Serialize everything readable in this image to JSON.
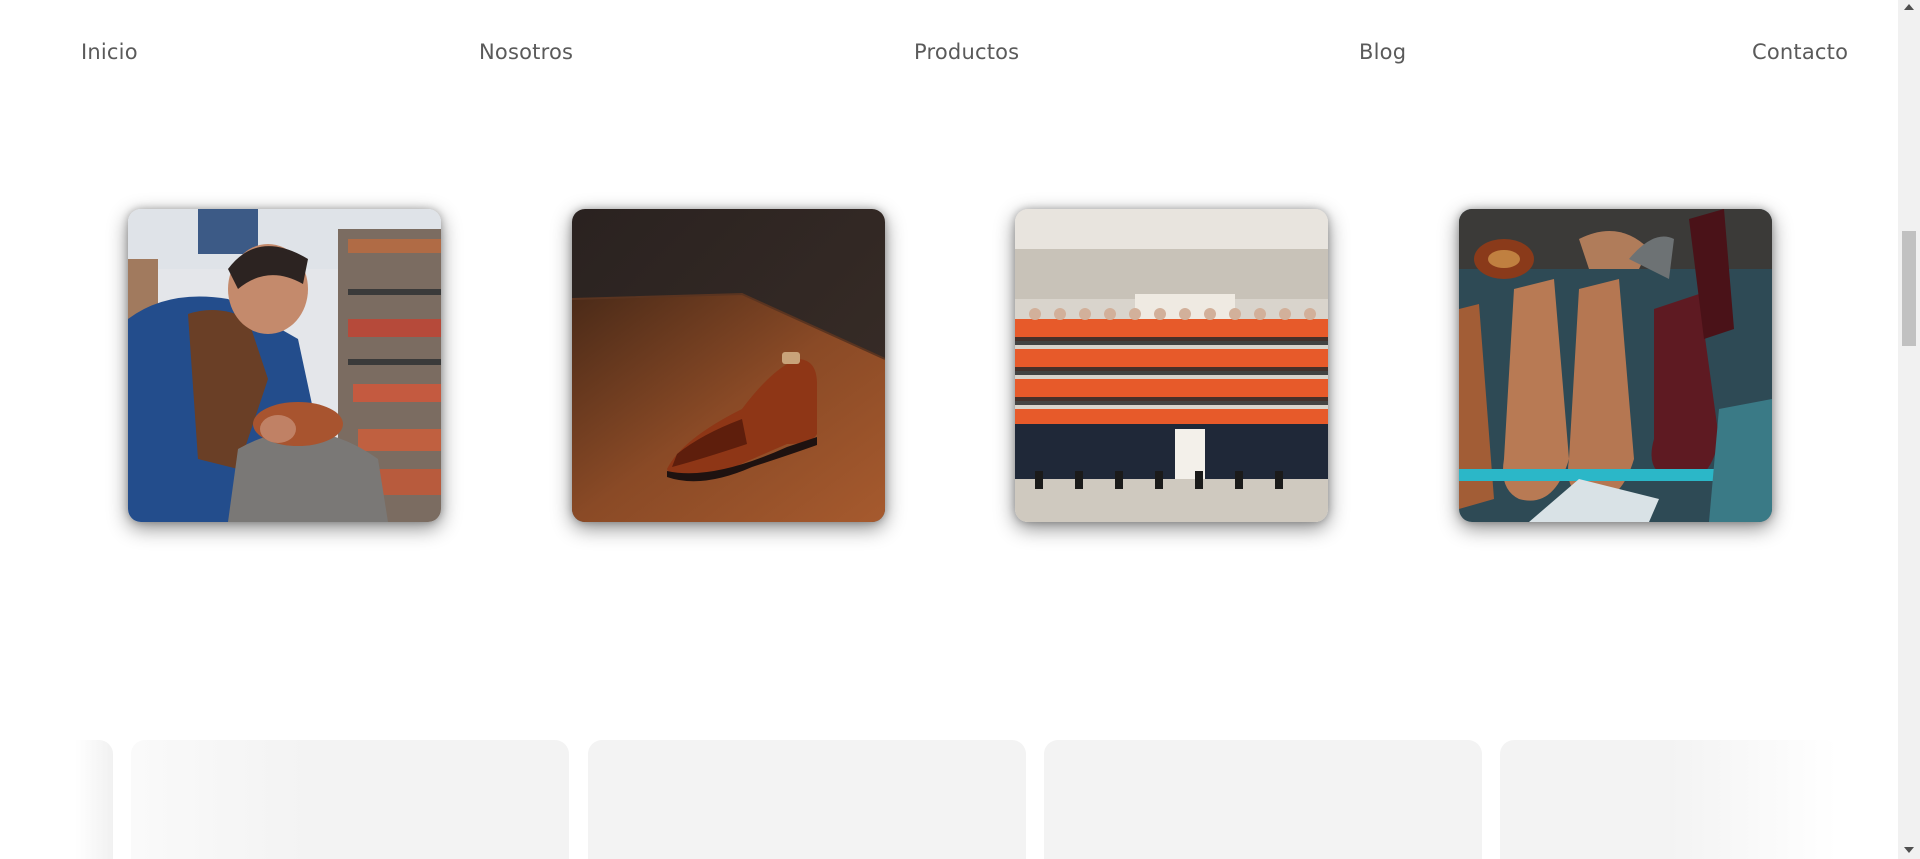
{
  "nav": {
    "items": [
      {
        "label": "Inicio"
      },
      {
        "label": "Nosotros"
      },
      {
        "label": "Productos"
      },
      {
        "label": "Blog"
      },
      {
        "label": "Contacto"
      }
    ]
  },
  "gallery": {
    "images": [
      {
        "icon": "artisan-working-photo"
      },
      {
        "icon": "leather-shoe-photo"
      },
      {
        "icon": "group-photo"
      },
      {
        "icon": "boots-photo"
      }
    ]
  },
  "colors": {
    "background": "#ffffff",
    "nav_text": "#5a5a5a",
    "panel": "#f3f3f3",
    "scrollbar_track": "#f1f1f1",
    "scrollbar_thumb": "#c1c1c1"
  }
}
